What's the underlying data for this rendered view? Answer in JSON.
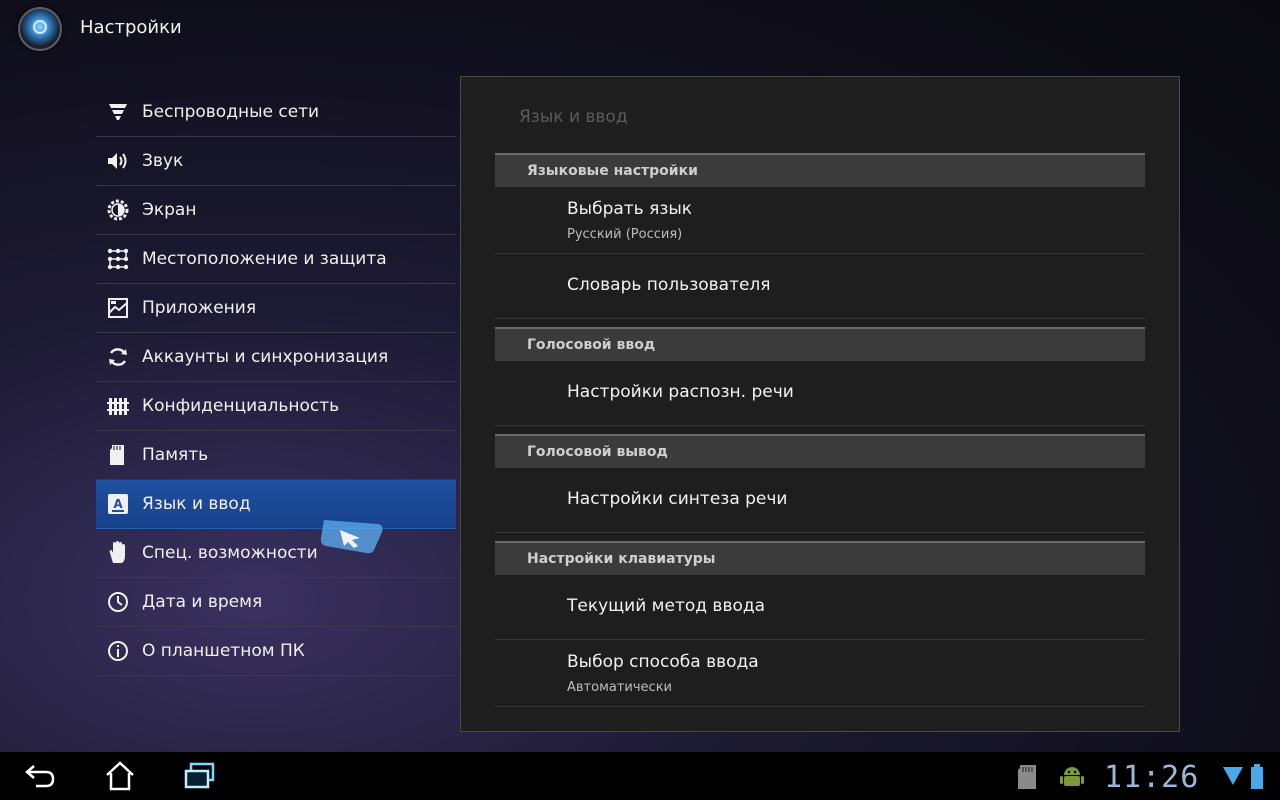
{
  "app": {
    "title": "Настройки",
    "icon": "settings-app-icon"
  },
  "menu": {
    "items": [
      {
        "label": "Беспроводные сети",
        "icon": "wifi-icon",
        "selected": false
      },
      {
        "label": "Звук",
        "icon": "speaker-icon",
        "selected": false
      },
      {
        "label": "Экран",
        "icon": "brightness-icon",
        "selected": false
      },
      {
        "label": "Местоположение и защита",
        "icon": "location-lock-icon",
        "selected": false
      },
      {
        "label": "Приложения",
        "icon": "apps-icon",
        "selected": false
      },
      {
        "label": "Аккаунты и синхронизация",
        "icon": "sync-icon",
        "selected": false
      },
      {
        "label": "Конфиденциальность",
        "icon": "fence-icon",
        "selected": false
      },
      {
        "label": "Память",
        "icon": "sd-card-icon",
        "selected": false
      },
      {
        "label": "Язык и ввод",
        "icon": "language-icon",
        "selected": true
      },
      {
        "label": "Спец. возможности",
        "icon": "hand-icon",
        "selected": false
      },
      {
        "label": "Дата и время",
        "icon": "clock-icon",
        "selected": false
      },
      {
        "label": "О планшетном ПК",
        "icon": "info-icon",
        "selected": false
      }
    ]
  },
  "panel": {
    "title": "Язык и ввод",
    "sections": [
      {
        "header": "Языковые настройки",
        "items": [
          {
            "title": "Выбрать язык",
            "summary": "Русский (Россия)"
          },
          {
            "title": "Словарь пользователя",
            "summary": ""
          }
        ]
      },
      {
        "header": "Голосовой ввод",
        "items": [
          {
            "title": "Настройки распозн. речи",
            "summary": ""
          }
        ]
      },
      {
        "header": "Голосовой вывод",
        "items": [
          {
            "title": "Настройки синтеза речи",
            "summary": ""
          }
        ]
      },
      {
        "header": "Настройки клавиатуры",
        "items": [
          {
            "title": "Текущий метод ввода",
            "summary": ""
          },
          {
            "title": "Выбор способа ввода",
            "summary": "Автоматически"
          }
        ]
      }
    ]
  },
  "statusbar": {
    "time": "11:26"
  },
  "colors": {
    "accent": "#1f4fa0",
    "clock": "#9cb8d8",
    "panel_bg": "#1e1e1e"
  }
}
